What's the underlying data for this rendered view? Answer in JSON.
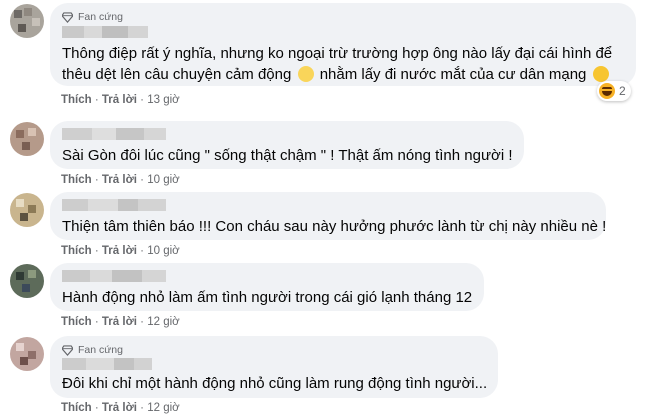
{
  "comments": [
    {
      "badge": "Fan cứng",
      "text": "Thông điệp rất ý nghĩa, nhưng ko ngoại trừ trường hợp ông nào lấy đại cái hình để",
      "text2_a": "thêu dệt lên câu chuyện cảm động",
      "text2_b": "nhằm lấy đi nước mắt của cư dân mạng",
      "like": "Thích",
      "reply": "Trả lời",
      "time": "13 giờ",
      "reaction_count": "2"
    },
    {
      "text": "Sài Gòn đôi lúc cũng \" sống thật chậm \" ! Thật ấm nóng tình người !",
      "like": "Thích",
      "reply": "Trả lời",
      "time": "10 giờ"
    },
    {
      "text": "Thiện tâm thiên báo !!! Con cháu sau này hưởng phước lành từ chị này nhiều nè !",
      "like": "Thích",
      "reply": "Trả lời",
      "time": "10 giờ"
    },
    {
      "text": "Hành động nhỏ làm ấm tình người trong cái gió lạnh tháng 12",
      "like": "Thích",
      "reply": "Trả lời",
      "time": "12 giờ"
    },
    {
      "badge": "Fan cứng",
      "text": "Đôi khi chỉ một hành động nhỏ cũng làm rung động tình người...",
      "like": "Thích",
      "reply": "Trả lời",
      "time": "12 giờ"
    }
  ],
  "separator": "·",
  "colors": {
    "bubble": "#f0f2f5",
    "meta": "#65676b",
    "text": "#050505"
  },
  "icons": {
    "badge": "diamond-icon",
    "emoji_1": "pensive-face-emoji",
    "emoji_2": "smiling-face-emoji",
    "reaction": "haha-reaction-icon"
  }
}
